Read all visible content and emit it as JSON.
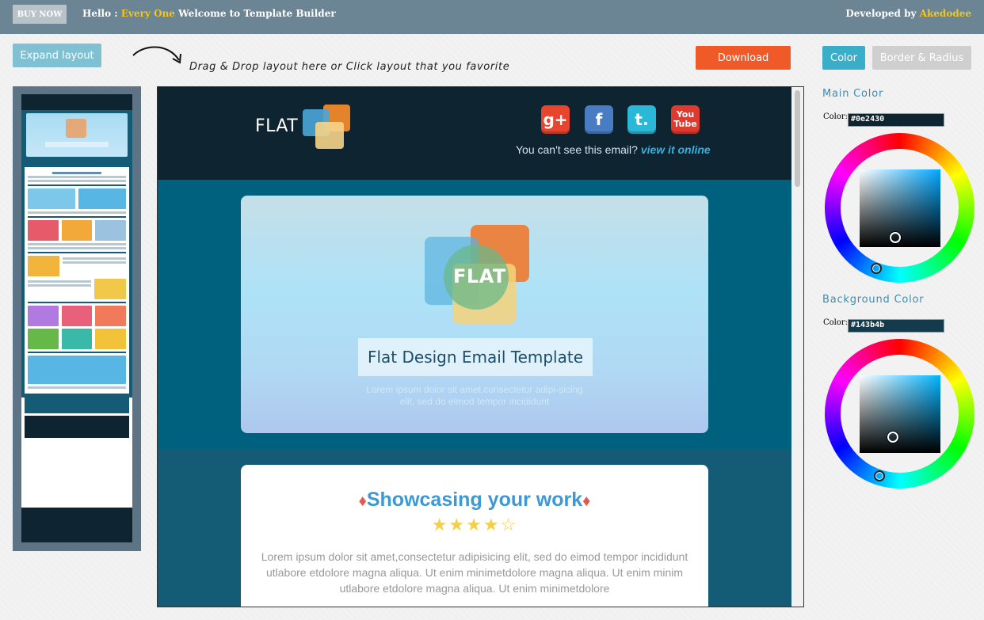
{
  "topbar": {
    "buy_label": "BUY NOW",
    "hello_prefix": "Hello : ",
    "hello_name": "Every One",
    "hello_suffix": " Welcome to Template Builder",
    "dev_prefix": "Developed by ",
    "dev_name": "Akedodee"
  },
  "toolbar": {
    "expand_label": "Expand layout",
    "hint": "Drag & Drop layout here or Click layout that you favorite",
    "download_label": "Download"
  },
  "panel": {
    "tabs": [
      {
        "label": "Color",
        "active": true
      },
      {
        "label": "Border & Radius",
        "active": false
      }
    ],
    "main_color_title": "Main Color",
    "main_color_label": "Color:",
    "main_color_value": "#0e2430",
    "bg_color_title": "Background Color",
    "bg_color_label": "Color:",
    "bg_color_value": "#143b4b"
  },
  "preview": {
    "logo_text": "FLAT",
    "social": [
      {
        "icon": "google-plus-icon",
        "glyph": "g+",
        "color": "#e8452e"
      },
      {
        "icon": "facebook-icon",
        "glyph": "f",
        "color": "#4a7cc4"
      },
      {
        "icon": "tumblr-icon",
        "glyph": "t.",
        "color": "#2bb8d8"
      },
      {
        "icon": "youtube-icon",
        "glyph": "You Tube",
        "color": "#e03a2e"
      }
    ],
    "cant_see": "You can't see this email? ",
    "view_online": "view it online",
    "hero_logo_text": "FLAT",
    "hero_title": "Flat Design Email Template",
    "hero_sub": "Lorem ipsum dolor sit amet,consectetur adipi-sicing elit, sed do eimod tempor incididunt",
    "show_title": "Showcasing your work",
    "stars": "★★★★☆",
    "show_text": "Lorem ipsum dolor sit amet,consectetur adipisicing elit, sed do eimod tempor incididunt utlabore etdolore magna aliqua. Ut enim minimetdolore magna aliqua. Ut enim minim utlabore etdolore magna aliqua. Ut enim minimetdolore"
  },
  "colors": {
    "topbar": "#6b8595",
    "accent": "#3aaec8",
    "download": "#f05a28",
    "header_bg": "#0e2430",
    "hero_bg": "#00617e",
    "section_bg": "#145b75"
  }
}
